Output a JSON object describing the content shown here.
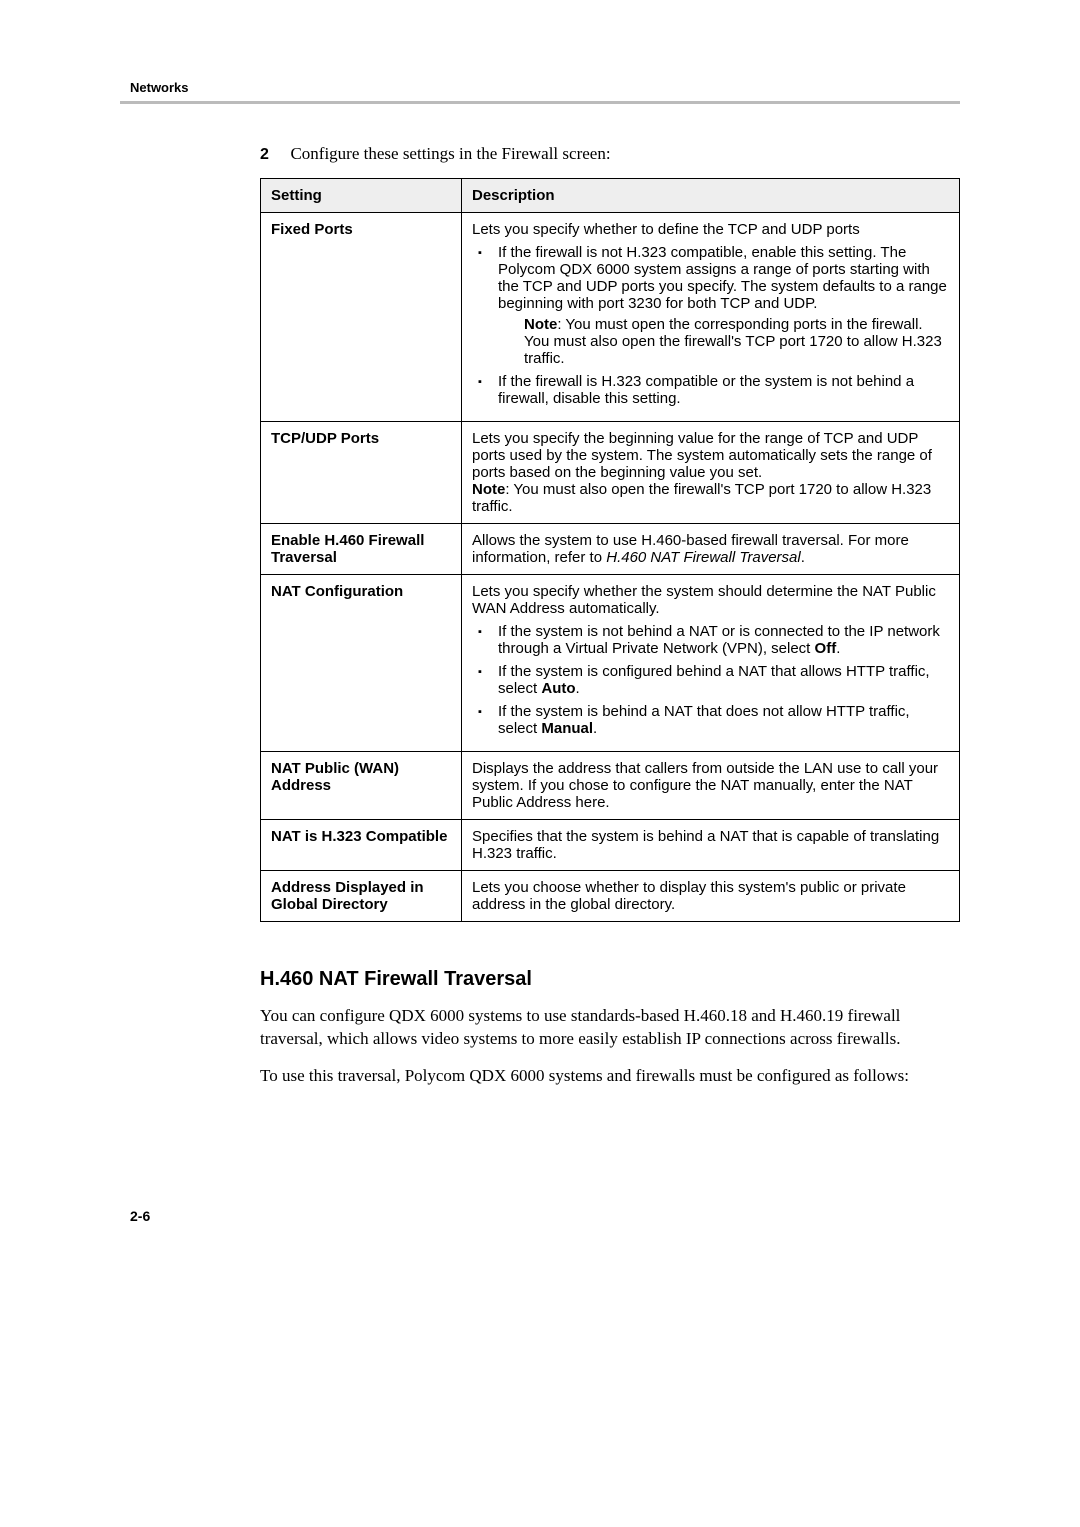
{
  "header": {
    "section": "Networks"
  },
  "step": {
    "num": "2",
    "text": "Configure these settings in the Firewall screen:"
  },
  "table": {
    "head": {
      "c1": "Setting",
      "c2": "Description"
    },
    "rows": [
      {
        "setting": "Fixed Ports",
        "lead": "Lets you specify whether to define the TCP and UDP ports",
        "b1": "If the firewall is not H.323 compatible, enable this setting. The Polycom QDX 6000 system assigns a range of ports starting with the TCP and UDP ports you specify. The system defaults to a range beginning with port 3230 for both TCP and UDP.",
        "note_label": "Note",
        "note_body": ": You must open the corresponding ports in the firewall. You must also open the firewall's TCP port 1720 to allow H.323 traffic.",
        "b2": "If the firewall is H.323 compatible or the system is not behind a firewall, disable this setting."
      },
      {
        "setting": "TCP/UDP Ports",
        "lead": "Lets you specify the beginning value for the range of TCP and UDP ports used by the system. The system automatically sets the range of ports based on the beginning value you set.",
        "note_label": "Note",
        "note_body": ": You must also open the firewall's TCP port 1720 to allow H.323 traffic."
      },
      {
        "setting": "Enable H.460 Firewall Traversal",
        "lead": "Allows the system to use H.460-based firewall traversal. For more information, refer to ",
        "italic_ref": "H.460 NAT Firewall Traversal",
        "trail": "."
      },
      {
        "setting": "NAT Configuration",
        "lead": "Lets you specify whether the system should determine the NAT Public WAN Address automatically.",
        "b1a": "If the system is not behind a NAT or is connected to the IP network through a Virtual Private Network (VPN), select ",
        "b1b": "Off",
        "b1c": ".",
        "b2a": "If the system is configured behind a NAT that allows HTTP traffic, select ",
        "b2b": "Auto",
        "b2c": ".",
        "b3a": "If the system is behind a NAT that does not allow HTTP traffic, select ",
        "b3b": "Manual",
        "b3c": "."
      },
      {
        "setting": "NAT Public (WAN) Address",
        "lead": "Displays the address that callers from outside the LAN use to call your system. If you chose to configure the NAT manually, enter the NAT Public Address here."
      },
      {
        "setting": "NAT is H.323 Compatible",
        "lead": "Specifies that the system is behind a NAT that is capable of translating H.323 traffic."
      },
      {
        "setting": "Address Displayed in Global Directory",
        "lead": "Lets you choose whether to display this system's public or private address in the global directory."
      }
    ]
  },
  "section": {
    "heading": "H.460 NAT Firewall Traversal",
    "p1": "You can configure QDX 6000 systems to use standards-based H.460.18 and H.460.19 firewall traversal, which allows video systems to more easily establish IP connections across firewalls.",
    "p2": "To use this traversal, Polycom QDX 6000 systems and firewalls must be configured as follows:"
  },
  "footer": {
    "page": "2-6"
  }
}
